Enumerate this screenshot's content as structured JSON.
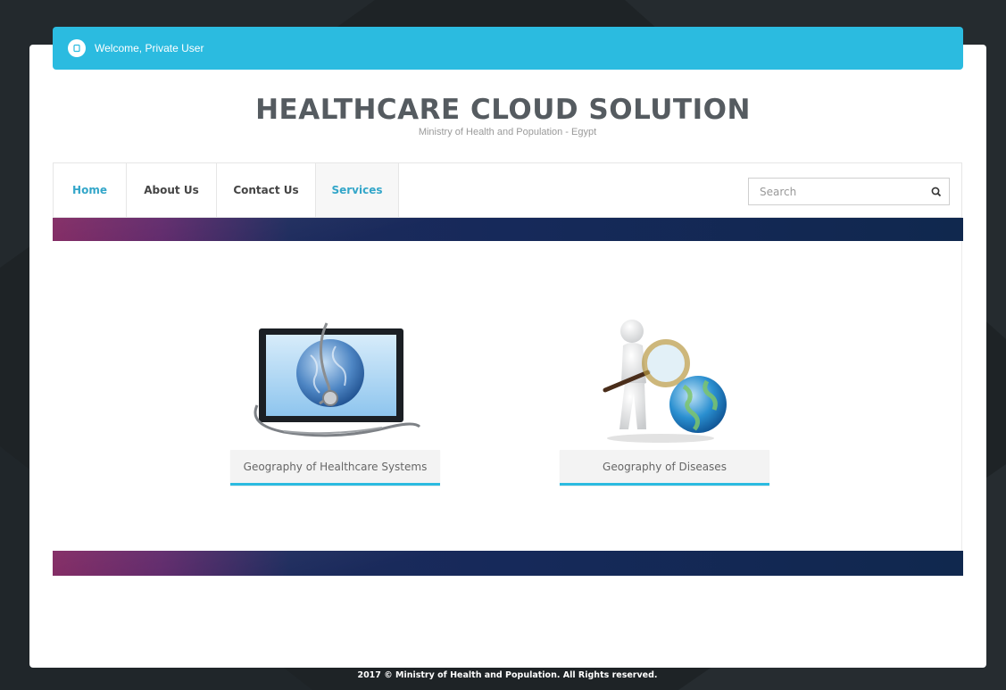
{
  "header": {
    "welcome_text": "Welcome, Private User",
    "site_title": "HEALTHCARE CLOUD SOLUTION",
    "site_subtitle": "Ministry of Health and Population - Egypt"
  },
  "nav": {
    "items": [
      {
        "label": "Home",
        "active": true
      },
      {
        "label": "About Us",
        "active": false
      },
      {
        "label": "Contact Us",
        "active": false
      },
      {
        "label": "Services",
        "active": true
      }
    ],
    "search": {
      "placeholder": "Search",
      "value": ""
    }
  },
  "services": [
    {
      "label": "Geography of Healthcare Systems",
      "icon": "monitor-globe-stethoscope-image"
    },
    {
      "label": "Geography of Diseases",
      "icon": "figure-magnifier-globe-image"
    }
  ],
  "footer": {
    "text": "2017 © Ministry of Health and Population. All Rights reserved."
  },
  "colors": {
    "accent": "#2bbbe0",
    "nav_active": "#33a6c9",
    "background": "#1e2326",
    "banner_dark": "#16295a",
    "banner_magenta": "#7a1d5a"
  }
}
